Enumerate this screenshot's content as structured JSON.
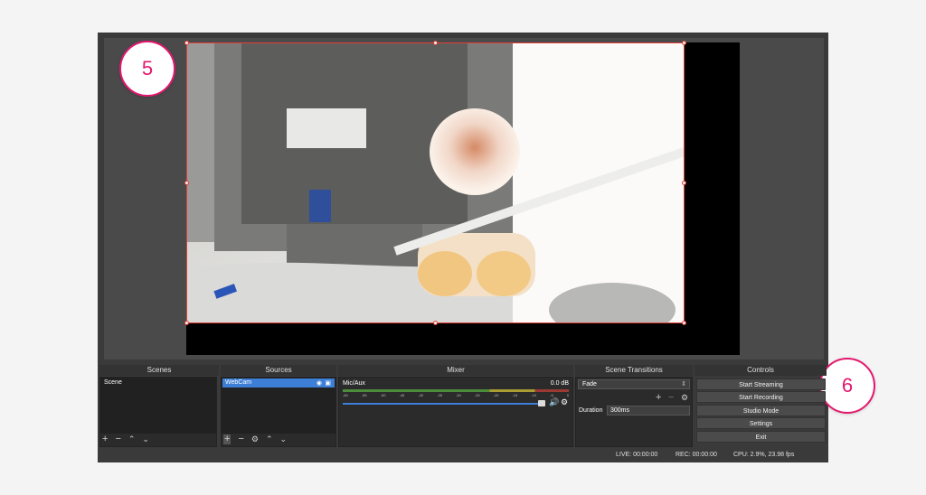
{
  "callouts": {
    "preview": "5",
    "controls": "6"
  },
  "docks": {
    "scenes": {
      "title": "Scenes",
      "items": [
        "Scene"
      ]
    },
    "sources": {
      "title": "Sources",
      "items": [
        "WebCam"
      ]
    },
    "mixer": {
      "title": "Mixer",
      "track_name": "Mic/Aux",
      "level": "0.0 dB",
      "ticks": [
        "-60",
        "-55",
        "-50",
        "-45",
        "-40",
        "-35",
        "-30",
        "-25",
        "-20",
        "-15",
        "-10",
        "-5",
        "0"
      ]
    },
    "transitions": {
      "title": "Scene Transitions",
      "transition": "Fade",
      "duration_label": "Duration",
      "duration": "300ms"
    },
    "controls": {
      "title": "Controls",
      "start_streaming": "Start Streaming",
      "start_recording": "Start Recording",
      "studio_mode": "Studio Mode",
      "settings": "Settings",
      "exit": "Exit"
    }
  },
  "status": {
    "live": "LIVE: 00:00:00",
    "rec": "REC: 00:00:00",
    "cpu": "CPU: 2.9%, 23.98 fps"
  },
  "colors": {
    "accent": "#e3186e",
    "selection": "#3d7fd6",
    "source_border": "#e0403a"
  },
  "icons": [
    "plus-icon",
    "minus-icon",
    "up-arrow-icon",
    "down-arrow-icon",
    "gear-icon",
    "eye-icon",
    "lock-icon",
    "speaker-icon"
  ]
}
